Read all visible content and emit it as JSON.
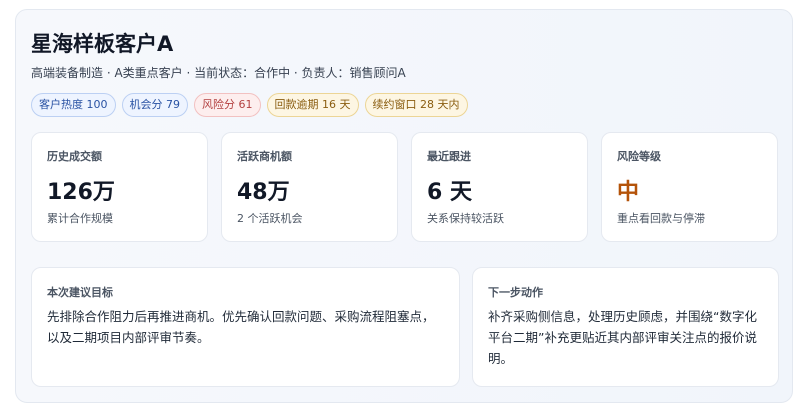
{
  "header": {
    "title": "星海样板客户A",
    "subtitle": "高端装备制造 · A类重点客户 · 当前状态：合作中 · 负责人：销售顾问A"
  },
  "badges": [
    {
      "label": "客户热度 100",
      "tone": "blue"
    },
    {
      "label": "机会分 79",
      "tone": "blue"
    },
    {
      "label": "风险分 61",
      "tone": "red"
    },
    {
      "label": "回款逾期 16 天",
      "tone": "amber"
    },
    {
      "label": "续约窗口 28 天内",
      "tone": "amber"
    }
  ],
  "stats": [
    {
      "label": "历史成交额",
      "value": "126万",
      "note": "累计合作规模"
    },
    {
      "label": "活跃商机额",
      "value": "48万",
      "note": "2 个活跃机会"
    },
    {
      "label": "最近跟进",
      "value": "6 天",
      "note": "关系保持较活跃"
    },
    {
      "label": "风险等级",
      "value": "中",
      "note": "重点看回款与停滞"
    }
  ],
  "goal": {
    "label": "本次建议目标",
    "text": "先排除合作阻力后再推进商机。优先确认回款问题、采购流程阻塞点，以及二期项目内部评审节奏。"
  },
  "next_action": {
    "label": "下一步动作",
    "text": "补齐采购侧信息，处理历史顾虑，并围绕“数字化平台二期”补充更贴近其内部评审关注点的报价说明。"
  },
  "colors": {
    "risk_value": "#b45309",
    "badge_blue": "#2952a3",
    "badge_red": "#b34040",
    "badge_amber": "#8a5d10"
  }
}
